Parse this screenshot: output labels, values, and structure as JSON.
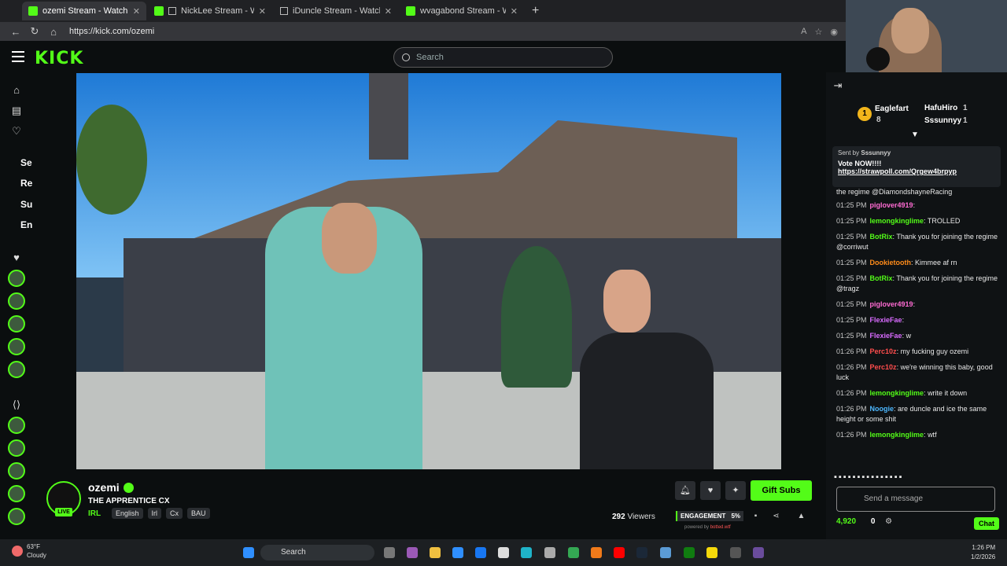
{
  "browser": {
    "tabs": [
      {
        "label": "ozemi Stream - Watch Live o",
        "active": true
      },
      {
        "label": "NickLee Stream - Watch Live",
        "active": false
      },
      {
        "label": "iDuncle Stream - Watch Live o",
        "active": false
      },
      {
        "label": "wvagabond Stream - Watch L",
        "active": false
      }
    ],
    "url": "https://kick.com/ozemi"
  },
  "header": {
    "logo": "KICK",
    "search_placeholder": "Search"
  },
  "sidebar": {
    "labels": [
      "Se",
      "Re",
      "Su",
      "En"
    ]
  },
  "stream": {
    "username": "ozemi",
    "live_label": "LIVE",
    "title": "THE APPRENTICE CX",
    "category": "IRL",
    "tags": [
      "English",
      "Irl",
      "Cx",
      "BAU"
    ],
    "gift_label": "Gift Subs",
    "viewers_count": "292",
    "viewers_label": "Viewers",
    "engagement_label": "ENGAGEMENT",
    "engagement_value": "5%",
    "powered_by": "powered by",
    "powered_name": "botted.wtf"
  },
  "chat": {
    "leaderboard": [
      {
        "name": "Eaglefart",
        "count": "8"
      },
      {
        "name": "HafuHiro",
        "count": "1"
      },
      {
        "name": "Sssunnyy",
        "count": "1"
      }
    ],
    "leader_rank": "1",
    "pinned": {
      "sent_by": "Sent by",
      "from": "Sssunnyy",
      "text": "Vote NOW!!!!",
      "link": "https://strawpoll.com/Qrgew4brpyp"
    },
    "partial_line": "the regime @DiamondshayneRacing",
    "messages": [
      {
        "ts": "01:25 PM",
        "nick": "piglover4919",
        "color": "#ff6bd3",
        "text": ""
      },
      {
        "ts": "01:25 PM",
        "nick": "lemongkinglime",
        "color": "#53fc18",
        "text": "TROLLED"
      },
      {
        "ts": "01:25 PM",
        "nick": "BotRix",
        "color": "#53fc18",
        "text": "Thank you for joining the regime @corriwut"
      },
      {
        "ts": "01:25 PM",
        "nick": "Dookietooth",
        "color": "#ff8c1a",
        "text": "Kimmee af rn"
      },
      {
        "ts": "01:25 PM",
        "nick": "BotRix",
        "color": "#53fc18",
        "text": "Thank you for joining the regime @tragz"
      },
      {
        "ts": "01:25 PM",
        "nick": "piglover4919",
        "color": "#ff6bd3",
        "text": ""
      },
      {
        "ts": "01:25 PM",
        "nick": "FlexieFae",
        "color": "#d96bff",
        "text": ""
      },
      {
        "ts": "01:25 PM",
        "nick": "FlexieFae",
        "color": "#d96bff",
        "text": "w"
      },
      {
        "ts": "01:26 PM",
        "nick": "Perc10z",
        "color": "#ff4d4d",
        "text": "my fucking guy ozemi"
      },
      {
        "ts": "01:26 PM",
        "nick": "Perc10z",
        "color": "#ff4d4d",
        "text": "we're winning this baby, good luck"
      },
      {
        "ts": "01:26 PM",
        "nick": "lemongkinglime",
        "color": "#53fc18",
        "text": "write it down"
      },
      {
        "ts": "01:26 PM",
        "nick": "Noogie",
        "color": "#4db8ff",
        "text": "are duncle and ice the same height or some shit"
      },
      {
        "ts": "01:26 PM",
        "nick": "lemongkinglime",
        "color": "#53fc18",
        "text": "wtf"
      }
    ],
    "input_placeholder": "Send a message",
    "points": "4,920",
    "subs_count": "0",
    "chat_button": "Chat"
  },
  "taskbar": {
    "temp": "63°F",
    "condition": "Cloudy",
    "search_label": "Search",
    "time": "1:26 PM",
    "date": "1/2/2026"
  },
  "colors": {
    "accent": "#53fc18",
    "background": "#0b0e0f"
  }
}
